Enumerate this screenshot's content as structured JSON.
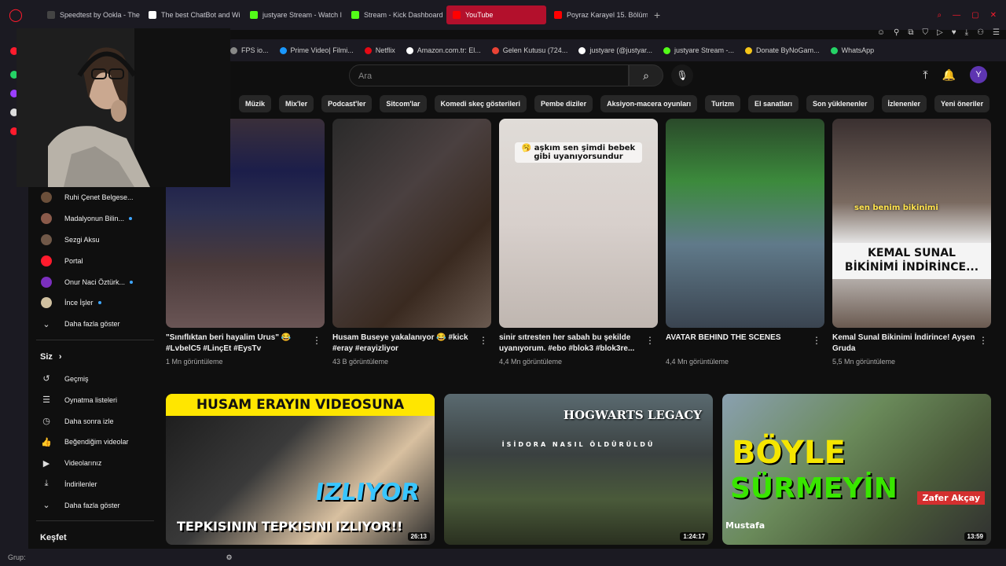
{
  "browser": {
    "tabs": [
      {
        "title": "Speedtest by Ookla - The",
        "color": "#444"
      },
      {
        "title": "The best ChatBot and Wi",
        "color": "#fff"
      },
      {
        "title": "justyare Stream - Watch l",
        "color": "#53fc18"
      },
      {
        "title": "Stream - Kick Dashboard",
        "color": "#53fc18"
      },
      {
        "title": "YouTube",
        "color": "#ff0000",
        "active": true
      },
      {
        "title": "Poyraz Karayel 15. Bölüm",
        "color": "#ff0000"
      }
    ],
    "new_tab": "+",
    "bookmarks": [
      {
        "label": "FPS io...",
        "color": "#888"
      },
      {
        "label": "Prime Video| Filmi...",
        "color": "#1a98ff"
      },
      {
        "label": "Netflix",
        "color": "#e50914"
      },
      {
        "label": "Amazon.com.tr: El...",
        "color": "#fff"
      },
      {
        "label": "Gelen Kutusu (724...",
        "color": "#ea4335"
      },
      {
        "label": "justyare (@justyar...",
        "color": "#fff"
      },
      {
        "label": "justyare Stream -...",
        "color": "#53fc18"
      },
      {
        "label": "Donate ByNoGam...",
        "color": "#f5c518"
      },
      {
        "label": "WhatsApp",
        "color": "#25d366"
      }
    ],
    "status_label": "Grup:"
  },
  "youtube": {
    "search_placeholder": "Ara",
    "avatar_letter": "Y",
    "chips": [
      "Müzik",
      "Mix'ler",
      "Podcast'ler",
      "Sitcom'lar",
      "Komedi skeç gösterileri",
      "Pembe diziler",
      "Aksiyon-macera oyunları",
      "Turizm",
      "El sanatları",
      "Son yüklenenler",
      "İzlenenler",
      "Yeni öneriler"
    ],
    "subscriptions": [
      {
        "label": "Ruhi Çenet Belgese...",
        "live": false
      },
      {
        "label": "Madalyonun Bilin...",
        "live": true
      },
      {
        "label": "Sezgi Aksu",
        "live": false
      },
      {
        "label": "Portal",
        "live": false
      },
      {
        "label": "Onur Naci Öztürk...",
        "live": true
      },
      {
        "label": "İnce İşler",
        "live": true
      }
    ],
    "show_more": "Daha fazla göster",
    "you_section": "Siz",
    "you_items": [
      {
        "label": "Geçmiş",
        "icon": "history-icon"
      },
      {
        "label": "Oynatma listeleri",
        "icon": "playlists-icon"
      },
      {
        "label": "Daha sonra izle",
        "icon": "clock-icon"
      },
      {
        "label": "Beğendiğim videolar",
        "icon": "thumbs-up-icon"
      },
      {
        "label": "Videolarınız",
        "icon": "video-icon"
      },
      {
        "label": "İndirilenler",
        "icon": "download-icon"
      }
    ],
    "show_more_2": "Daha fazla göster",
    "explore": "Keşfet",
    "shorts": [
      {
        "title": "\"Sınıflıktan beri hayalim Urus\" 😂 #LvbelC5 #LinçEt #EysTv",
        "views": "1 Mn görüntüleme",
        "overlay": ""
      },
      {
        "title": "Husam Buseye yakalanıyor 😂 #kick #eray #erayizliyor",
        "views": "43 B görüntüleme",
        "overlay": ""
      },
      {
        "title": "sinir sıtresten her sabah bu şekilde uyanıyorum. #ebo #blok3 #blok3re...",
        "views": "4,4 Mn görüntüleme",
        "overlay": "🥱 aşkım sen şimdi bebek gibi uyanıyorsundur"
      },
      {
        "title": "AVATAR BEHIND THE SCENES",
        "views": "4,4 Mn görüntüleme",
        "overlay": ""
      },
      {
        "title": "Kemal Sunal Bikinimi İndirince! Ayşen Gruda",
        "views": "5,5 Mn görüntüleme",
        "overlay": "sen benim bikinimi",
        "overlay2": "KEMAL SUNAL BİKİNİMİ İNDİRİNCE..."
      }
    ],
    "videos": [
      {
        "duration": "26:13",
        "top_text": "HUSAM ERAYIN VIDEOSUNA",
        "mid_text": "IZLIYOR",
        "bottom_text": "TEPKISININ TEPKISINI IZLIYOR!!"
      },
      {
        "duration": "1:24:17",
        "top_text": "HOGWARTS LEGACY",
        "mid_text": "İSİDORA NASIL ÖLDÜRÜLDÜ",
        "bottom_text": ""
      },
      {
        "duration": "13:59",
        "top_text": "BÖYLE",
        "mid_text": "SÜRMEYİN",
        "bottom_text": "Zafer Akçay",
        "extra": "Mustafa"
      }
    ]
  }
}
